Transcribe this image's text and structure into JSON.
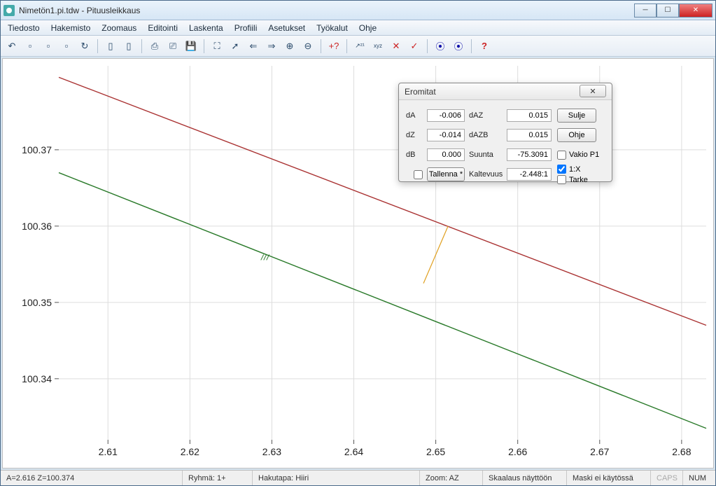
{
  "window": {
    "title": "Nimetön1.pi.tdw - Pituusleikkaus"
  },
  "menu": [
    "Tiedosto",
    "Hakemisto",
    "Zoomaus",
    "Editointi",
    "Laskenta",
    "Profiili",
    "Asetukset",
    "Työkalut",
    "Ohje"
  ],
  "toolbar_icons": [
    "undo-icon",
    "new-icon",
    "open-icon",
    "open2-icon",
    "page-icon",
    "|",
    "blank-icon",
    "copy-icon",
    "|",
    "print-icon",
    "print-queue-icon",
    "save-icon",
    "|",
    "expand-icon",
    "arrow-cursor-icon",
    "left-arrow-icon",
    "right-arrow-icon",
    "zoom-in-icon",
    "zoom-out-icon",
    "|",
    "addpoint-icon",
    "|",
    "measure-xy-icon",
    "ruler-icon",
    "snap-icon",
    "check-xy-icon",
    "|",
    "play-back-icon",
    "play-fwd-icon",
    "|",
    "help-icon"
  ],
  "chart_data": {
    "type": "line",
    "xlabel": "",
    "ylabel": "",
    "x_ticks": [
      2.61,
      2.62,
      2.63,
      2.64,
      2.65,
      2.66,
      2.67,
      2.68
    ],
    "y_ticks": [
      100.34,
      100.35,
      100.36,
      100.37
    ],
    "x_range": [
      2.604,
      2.683
    ],
    "y_range": [
      100.332,
      100.381
    ],
    "series": [
      {
        "name": "line-red",
        "color": "#a33",
        "points": [
          [
            2.604,
            100.3795
          ],
          [
            2.683,
            100.347
          ]
        ]
      },
      {
        "name": "line-green",
        "color": "#2a7a2a",
        "points": [
          [
            2.604,
            100.367
          ],
          [
            2.683,
            100.3335
          ]
        ]
      }
    ],
    "connector": {
      "color": "#e0a020",
      "points": [
        [
          2.6485,
          100.3525
        ],
        [
          2.6515,
          100.36
        ]
      ]
    },
    "hatch_mark": {
      "x": 2.629,
      "y": 100.356
    }
  },
  "panel": {
    "title": "Eromitat",
    "dA": "-0.006",
    "dZ": "-0.014",
    "dB": "0.000",
    "dAZ": "0.015",
    "dAZB": "0.015",
    "Suunta": "-75.3091",
    "Kaltevuus": "-2.448:1",
    "labels": {
      "dA": "dA",
      "dZ": "dZ",
      "dB": "dB",
      "dAZ": "dAZ",
      "dAZB": "dAZB",
      "Suunta": "Suunta",
      "Kaltevuus": "Kaltevuus"
    },
    "tallenna": "Tallenna *",
    "buttons": {
      "sulje": "Sulje",
      "ohje": "Ohje"
    },
    "checks": {
      "vakio": "Vakio P1",
      "onex": "1:X",
      "tarke": "Tarke"
    },
    "onex_checked": true
  },
  "status": {
    "coords": "A=2.616  Z=100.374",
    "ryhma": "Ryhmä: 1+",
    "hakutapa": "Hakutapa: Hiiri",
    "zoom": "Zoom: AZ",
    "skaalaus": "Skaalaus näyttöön",
    "maski": "Maski ei käytössä",
    "caps": "CAPS",
    "num": "NUM"
  }
}
